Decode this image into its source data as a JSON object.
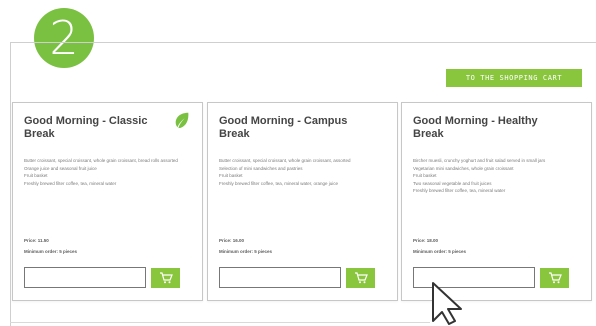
{
  "step": {
    "number": "2"
  },
  "header": {
    "cart_button_label": "TO THE SHOPPING CART"
  },
  "colors": {
    "accent": "#8ac53e",
    "badge": "#7ac142"
  },
  "products": [
    {
      "title": "Good Morning - Classic Break",
      "icon": "leaf-icon",
      "description": "Butter croissant, special croissant, whole grain croissant, bread rolls assorted\nOrange juice and seasonal fruit juice\nFruit basket\nFreshly brewed filter coffee, tea, mineral water",
      "price": "Price: 11.50",
      "min_order": "Minimum order: 5 pieces",
      "quantity_value": ""
    },
    {
      "title": "Good Morning - Campus Break",
      "description": "Butter croissant, special croissant, whole grain croissant, assorted\nSelection of mini sandwiches and pastries\nFruit basket\nFreshly brewed filter coffee, tea, mineral water, orange juice",
      "price": "Price: 16.00",
      "min_order": "Minimum order: 5 pieces",
      "quantity_value": ""
    },
    {
      "title": "Good Morning - Healthy Break",
      "description": "Bircher muesli, crunchy yoghurt and fruit salad served in small jars\nVegetarian mini sandwiches, whole grain croissant\nFruit basket\nTwo seasonal vegetable and fruit juices\nFreshly brewed filter coffee, tea, mineral water",
      "price": "Price: 18.00",
      "min_order": "Minimum order: 5 pieces",
      "quantity_value": ""
    }
  ],
  "cursor": {
    "icon": "mouse-pointer-icon"
  }
}
